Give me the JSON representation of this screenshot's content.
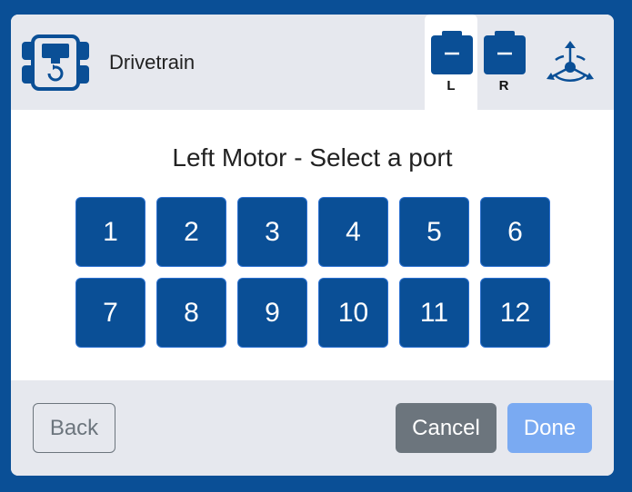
{
  "header": {
    "title": "Drivetrain",
    "device_icon": "drivetrain-device-icon",
    "tabs": [
      {
        "label": "L",
        "icon": "motor-icon",
        "active": true
      },
      {
        "label": "R",
        "icon": "motor-icon",
        "active": false
      }
    ],
    "gyro_icon": "gyro-sensor-icon"
  },
  "main": {
    "prompt": "Left Motor - Select a port",
    "ports": [
      "1",
      "2",
      "3",
      "4",
      "5",
      "6",
      "7",
      "8",
      "9",
      "10",
      "11",
      "12"
    ]
  },
  "footer": {
    "back_label": "Back",
    "cancel_label": "Cancel",
    "done_label": "Done"
  },
  "colors": {
    "brand_blue": "#0a4f96",
    "panel_gray": "#e6e8ee",
    "cancel_gray": "#6c757d",
    "done_disabled": "#7aaaf2"
  }
}
